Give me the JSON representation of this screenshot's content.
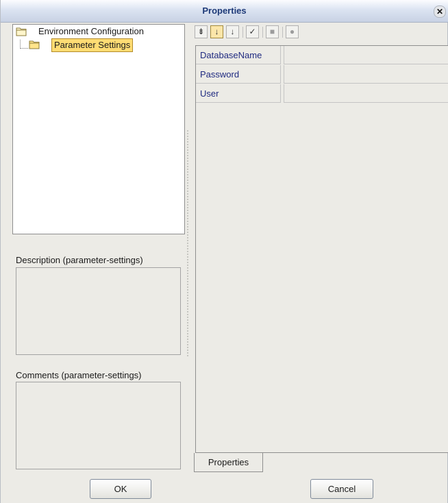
{
  "window": {
    "title": "Properties"
  },
  "tree": {
    "root_label": "Environment Configuration",
    "child_label": "Parameter Settings"
  },
  "description": {
    "label": "Description (parameter-settings)"
  },
  "comments": {
    "label": "Comments (parameter-settings)"
  },
  "toolbar": {
    "icons": [
      "expand-icon",
      "sort-alphabetical-icon",
      "sort-category-icon",
      "checklist-icon",
      "help-panel-icon",
      "info-icon"
    ]
  },
  "properties": {
    "rows": [
      {
        "name": "DatabaseName",
        "value": ""
      },
      {
        "name": "Password",
        "value": ""
      },
      {
        "name": "User",
        "value": ""
      }
    ],
    "tab_label": "Properties"
  },
  "buttons": {
    "ok_label": "OK",
    "cancel_label": "Cancel"
  },
  "colors": {
    "selection_highlight": "#ffdc73",
    "property_name_text": "#1f2a80",
    "title_text": "#1e3a78"
  }
}
